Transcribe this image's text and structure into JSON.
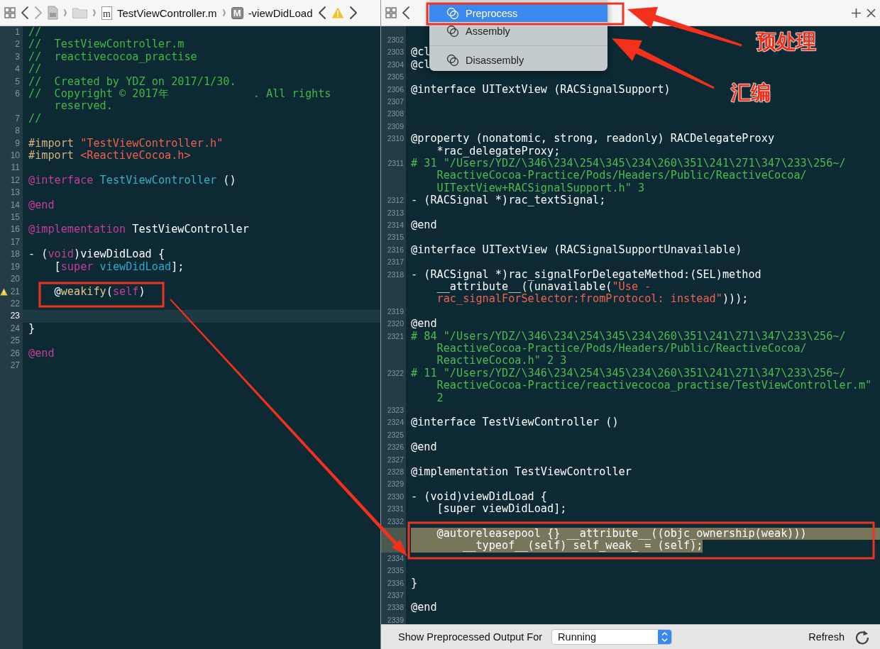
{
  "left_editor": {
    "jump_bar": {
      "items": [
        {
          "kind": "file",
          "icon_letter": "m",
          "label": "TestViewController.m"
        },
        {
          "kind": "method",
          "icon_letter": "M",
          "label": "-viewDidLoad"
        }
      ]
    },
    "lines": [
      {
        "number": "1",
        "current": false,
        "warning": false,
        "rows": [
          [
            {
              "kind": "comment",
              "text": "//"
            }
          ]
        ]
      },
      {
        "number": "2",
        "current": false,
        "warning": false,
        "rows": [
          [
            {
              "kind": "comment",
              "text": "//  TestViewController.m"
            }
          ]
        ]
      },
      {
        "number": "3",
        "current": false,
        "warning": false,
        "rows": [
          [
            {
              "kind": "comment",
              "text": "//  reactivecocoa_practise"
            }
          ]
        ]
      },
      {
        "number": "4",
        "current": false,
        "warning": false,
        "rows": [
          [
            {
              "kind": "comment",
              "text": "//"
            }
          ]
        ]
      },
      {
        "number": "5",
        "current": false,
        "warning": false,
        "rows": [
          [
            {
              "kind": "comment",
              "text": "//  Created by YDZ on 2017/1/30."
            }
          ]
        ]
      },
      {
        "number": "6",
        "current": false,
        "warning": false,
        "rows": [
          [
            {
              "kind": "comment",
              "text": "//  Copyright © 2017年             . All rights"
            }
          ],
          [
            {
              "kind": "comment",
              "text": "reserved."
            }
          ]
        ]
      },
      {
        "number": "7",
        "current": false,
        "warning": false,
        "rows": [
          [
            {
              "kind": "comment",
              "text": "//"
            }
          ]
        ]
      },
      {
        "number": "8",
        "current": false,
        "warning": false
      },
      {
        "number": "9",
        "current": false,
        "warning": false,
        "rows": [
          [
            {
              "kind": "preprocessor",
              "text": "#import "
            },
            {
              "kind": "string",
              "text": "\"TestViewController.h\""
            }
          ]
        ]
      },
      {
        "number": "10",
        "current": false,
        "warning": false,
        "rows": [
          [
            {
              "kind": "preprocessor",
              "text": "#import "
            },
            {
              "kind": "string",
              "text": "<ReactiveCocoa.h>"
            }
          ]
        ]
      },
      {
        "number": "11",
        "current": false,
        "warning": false
      },
      {
        "number": "12",
        "current": false,
        "warning": false,
        "rows": [
          [
            {
              "kind": "keyword",
              "text": "@interface"
            },
            {
              "kind": "plain",
              "text": " "
            },
            {
              "kind": "class",
              "text": "TestViewController"
            },
            {
              "kind": "plain",
              "text": " ()"
            }
          ]
        ]
      },
      {
        "number": "13",
        "current": false,
        "warning": false
      },
      {
        "number": "14",
        "current": false,
        "warning": false,
        "rows": [
          [
            {
              "kind": "keyword",
              "text": "@end"
            }
          ]
        ]
      },
      {
        "number": "15",
        "current": false,
        "warning": false
      },
      {
        "number": "16",
        "current": false,
        "warning": false,
        "rows": [
          [
            {
              "kind": "keyword",
              "text": "@implementation"
            },
            {
              "kind": "plain",
              "text": " TestViewController"
            }
          ]
        ]
      },
      {
        "number": "17",
        "current": false,
        "warning": false
      },
      {
        "number": "18",
        "current": false,
        "warning": false,
        "rows": [
          [
            {
              "kind": "plain",
              "text": "- ("
            },
            {
              "kind": "keyword",
              "text": "void"
            },
            {
              "kind": "plain",
              "text": ")viewDidLoad {"
            }
          ]
        ]
      },
      {
        "number": "19",
        "current": false,
        "warning": false,
        "rows": [
          [
            {
              "kind": "plain",
              "text": "    ["
            },
            {
              "kind": "keyword",
              "text": "super"
            },
            {
              "kind": "plain",
              "text": " "
            },
            {
              "kind": "method",
              "text": "viewDidLoad"
            },
            {
              "kind": "plain",
              "text": "];"
            }
          ]
        ]
      },
      {
        "number": "20",
        "current": false,
        "warning": false
      },
      {
        "number": "21",
        "current": false,
        "warning": true,
        "rows": [
          [
            {
              "kind": "plain",
              "text": "    @"
            },
            {
              "kind": "macro",
              "text": "weakify"
            },
            {
              "kind": "plain",
              "text": "("
            },
            {
              "kind": "keyword",
              "text": "self"
            },
            {
              "kind": "plain",
              "text": ")"
            }
          ]
        ]
      },
      {
        "number": "22",
        "current": false,
        "warning": false
      },
      {
        "number": "23",
        "current": true,
        "warning": false
      },
      {
        "number": "24",
        "current": false,
        "warning": false,
        "rows": [
          [
            {
              "kind": "plain",
              "text": "}"
            }
          ]
        ]
      },
      {
        "number": "25",
        "current": false,
        "warning": false
      },
      {
        "number": "26",
        "current": false,
        "warning": false,
        "rows": [
          [
            {
              "kind": "keyword",
              "text": "@end"
            }
          ]
        ]
      },
      {
        "number": "27",
        "current": false,
        "warning": false
      }
    ]
  },
  "right_editor": {
    "menu": {
      "items": [
        {
          "kind": "item",
          "label": "Preprocess",
          "selected": true
        },
        {
          "kind": "item",
          "label": "Assembly",
          "selected": false
        },
        {
          "kind": "separator"
        },
        {
          "kind": "item",
          "label": "Disassembly",
          "selected": false
        }
      ]
    },
    "lines": [
      {
        "number": "2302",
        "selected": false
      },
      {
        "number": "2303",
        "selected": false,
        "rows": [
          [
            {
              "kind": "plain",
              "text": "@cl"
            }
          ]
        ]
      },
      {
        "number": "2304",
        "selected": false,
        "rows": [
          [
            {
              "kind": "plain",
              "text": "@cl"
            }
          ]
        ]
      },
      {
        "number": "2305",
        "selected": false
      },
      {
        "number": "2306",
        "selected": false,
        "rows": [
          [
            {
              "kind": "plain",
              "text": "@interface UITextView (RACSignalSupport)"
            }
          ]
        ]
      },
      {
        "number": "2307",
        "selected": false
      },
      {
        "number": "2308",
        "selected": false
      },
      {
        "number": "2309",
        "selected": false
      },
      {
        "number": "2310",
        "selected": false,
        "rows": [
          [
            {
              "kind": "plain",
              "text": "@property (nonatomic, strong, readonly) RACDelegateProxy"
            }
          ],
          [
            {
              "kind": "plain",
              "text": "*rac_delegateProxy;"
            }
          ]
        ]
      },
      {
        "number": "2311",
        "selected": false,
        "rows": [
          [
            {
              "kind": "directive",
              "text": "# 31 \"/Users/YDZ/\\346\\234\\254\\345\\234\\260\\351\\241\\271\\347\\233\\256~/"
            }
          ],
          [
            {
              "kind": "directive",
              "text": "ReactiveCocoa-Practice/Pods/Headers/Public/ReactiveCocoa/"
            }
          ],
          [
            {
              "kind": "directive",
              "text": "UITextView+RACSignalSupport.h\" 3"
            }
          ]
        ]
      },
      {
        "number": "2312",
        "selected": false,
        "rows": [
          [
            {
              "kind": "plain",
              "text": "- (RACSignal *)rac_textSignal;"
            }
          ]
        ]
      },
      {
        "number": "2313",
        "selected": false
      },
      {
        "number": "2314",
        "selected": false,
        "rows": [
          [
            {
              "kind": "plain",
              "text": "@end"
            }
          ]
        ]
      },
      {
        "number": "2315",
        "selected": false
      },
      {
        "number": "2316",
        "selected": false,
        "rows": [
          [
            {
              "kind": "plain",
              "text": "@interface UITextView (RACSignalSupportUnavailable)"
            }
          ]
        ]
      },
      {
        "number": "2317",
        "selected": false
      },
      {
        "number": "2318",
        "selected": false,
        "rows": [
          {
            "segments": [
              {
                "kind": "plain",
                "text": "- (RACSignal *)rac_signalForDelegateMethod:(SEL)method"
              }
            ]
          },
          {
            "segments": [
              {
                "kind": "plain",
                "text": "__attribute__((unavailable("
              },
              {
                "kind": "string",
                "text": "\"Use -"
              }
            ]
          },
          {
            "segments": [
              {
                "kind": "string",
                "text": "rac_signalForSelector:fromProtocol: instead\""
              },
              {
                "kind": "plain",
                "text": ")));"
              }
            ]
          }
        ]
      },
      {
        "number": "2319",
        "selected": false
      },
      {
        "number": "2320",
        "selected": false,
        "rows": [
          [
            {
              "kind": "plain",
              "text": "@end"
            }
          ]
        ]
      },
      {
        "number": "2321",
        "selected": false,
        "rows": [
          [
            {
              "kind": "directive",
              "text": "# 84 \"/Users/YDZ/\\346\\234\\254\\345\\234\\260\\351\\241\\271\\347\\233\\256~/"
            }
          ],
          [
            {
              "kind": "directive",
              "text": "ReactiveCocoa-Practice/Pods/Headers/Public/ReactiveCocoa/"
            }
          ],
          [
            {
              "kind": "directive",
              "text": "ReactiveCocoa.h\" 2 3"
            }
          ]
        ]
      },
      {
        "number": "2322",
        "selected": false,
        "rows": [
          [
            {
              "kind": "directive",
              "text": "# 11 \"/Users/YDZ/\\346\\234\\254\\345\\234\\260\\351\\241\\271\\347\\233\\256~/"
            }
          ],
          [
            {
              "kind": "directive",
              "text": "ReactiveCocoa-Practice/reactivecocoa_practise/TestViewController.m\""
            }
          ],
          [
            {
              "kind": "directive",
              "text": "2"
            }
          ]
        ]
      },
      {
        "number": "2323",
        "selected": false
      },
      {
        "number": "2324",
        "selected": false,
        "rows": [
          [
            {
              "kind": "plain",
              "text": "@interface TestViewController ()"
            }
          ]
        ]
      },
      {
        "number": "2325",
        "selected": false
      },
      {
        "number": "2326",
        "selected": false,
        "rows": [
          [
            {
              "kind": "plain",
              "text": "@end"
            }
          ]
        ]
      },
      {
        "number": "2327",
        "selected": false
      },
      {
        "number": "2328",
        "selected": false,
        "rows": [
          [
            {
              "kind": "plain",
              "text": "@implementation TestViewController"
            }
          ]
        ]
      },
      {
        "number": "2329",
        "selected": false
      },
      {
        "number": "2330",
        "selected": false,
        "rows": [
          [
            {
              "kind": "plain",
              "text": "- (void)viewDidLoad {"
            }
          ]
        ]
      },
      {
        "number": "2331",
        "selected": false,
        "rows": [
          [
            {
              "kind": "plain",
              "text": "    [super viewDidLoad];"
            }
          ]
        ]
      },
      {
        "number": "2332",
        "selected": false
      },
      {
        "selected": true,
        "rows": [
          [
            {
              "kind": "plain",
              "text": "    @autoreleasepool {} __attribute__((objc_ownership(weak)))"
            }
          ],
          [
            {
              "kind": "plain",
              "text": "__typeof__(self) self_weak_ = (self);"
            }
          ]
        ]
      },
      {
        "number": "2334",
        "selected": false
      },
      {
        "number": "2335",
        "selected": false
      },
      {
        "number": "2336",
        "selected": false,
        "rows": [
          [
            {
              "kind": "plain",
              "text": "}"
            }
          ]
        ]
      },
      {
        "number": "2337",
        "selected": false
      },
      {
        "number": "2338",
        "selected": false,
        "rows": [
          [
            {
              "kind": "plain",
              "text": "@end"
            }
          ]
        ]
      },
      {
        "number": "2339",
        "selected": false
      }
    ],
    "bottom_bar": {
      "label": "Show Preprocessed Output For",
      "popup": {
        "value": "Running"
      },
      "refresh_label": "Refresh"
    }
  },
  "annotations": {
    "labels": [
      {
        "text": "预处理"
      },
      {
        "text": "汇编"
      }
    ]
  }
}
